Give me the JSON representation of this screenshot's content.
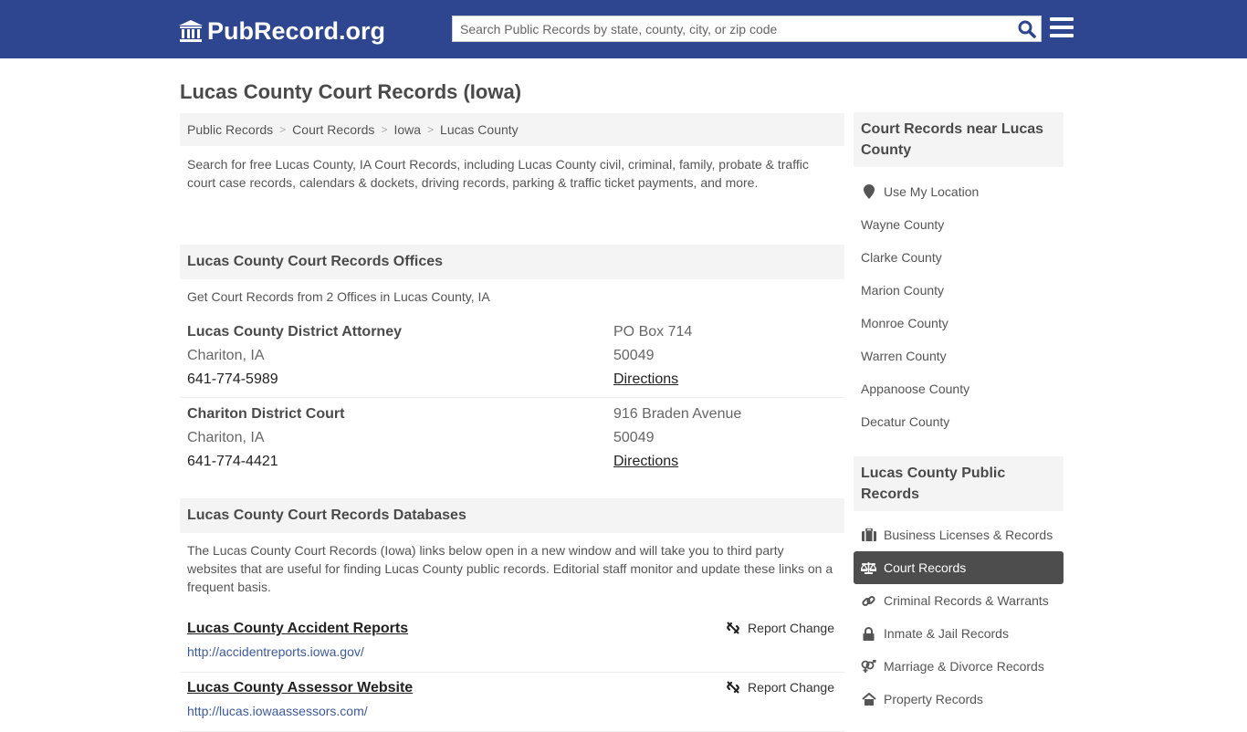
{
  "header": {
    "site_name": "PubRecord.org",
    "search_placeholder": "Search Public Records by state, county, city, or zip code",
    "search_value": ""
  },
  "page_title": "Lucas County Court Records (Iowa)",
  "breadcrumb": [
    "Public Records",
    "Court Records",
    "Iowa",
    "Lucas County"
  ],
  "intro": "Search for free Lucas County, IA Court Records, including Lucas County civil, criminal, family, probate & traffic court case records, calendars & dockets, driving records, parking & traffic ticket payments, and more.",
  "offices": {
    "heading": "Lucas County Court Records Offices",
    "subheading": "Get Court Records from 2 Offices in Lucas County, IA",
    "items": [
      {
        "name": "Lucas County District Attorney",
        "city": "Chariton, IA",
        "phone": "641-774-5989",
        "address": "PO Box 714",
        "zip": "50049",
        "directions": "Directions"
      },
      {
        "name": "Chariton District Court",
        "city": "Chariton, IA",
        "phone": "641-774-4421",
        "address": "916 Braden Avenue",
        "zip": "50049",
        "directions": "Directions"
      }
    ]
  },
  "databases": {
    "heading": "Lucas County Court Records Databases",
    "intro": "The Lucas County Court Records (Iowa) links below open in a new window and will take you to third party websites that are useful for finding Lucas County public records. Editorial staff monitor and update these links on a frequent basis.",
    "report_label": "Report Change",
    "items": [
      {
        "title": "Lucas County Accident Reports",
        "url": "http://accidentreports.iowa.gov/"
      },
      {
        "title": "Lucas County Assessor Website",
        "url": "http://lucas.iowaassessors.com/"
      }
    ]
  },
  "sidebar_nearby": {
    "heading": "Court Records near Lucas County",
    "use_location": "Use My Location",
    "counties": [
      "Wayne County",
      "Clarke County",
      "Marion County",
      "Monroe County",
      "Warren County",
      "Appanoose County",
      "Decatur County"
    ]
  },
  "sidebar_public": {
    "heading": "Lucas County Public Records",
    "items": [
      {
        "label": "Business Licenses & Records",
        "icon": "briefcase-icon",
        "active": false
      },
      {
        "label": "Court Records",
        "icon": "scale-icon",
        "active": true
      },
      {
        "label": "Criminal Records & Warrants",
        "icon": "link-icon",
        "active": false
      },
      {
        "label": "Inmate & Jail Records",
        "icon": "lock-icon",
        "active": false
      },
      {
        "label": "Marriage & Divorce Records",
        "icon": "venus-mars-icon",
        "active": false
      },
      {
        "label": "Property Records",
        "icon": "home-icon",
        "active": false
      }
    ]
  },
  "colors": {
    "header_bg": "#2e4690",
    "active_item_bg": "#4d4d4d",
    "url_link": "#3d5a98"
  }
}
